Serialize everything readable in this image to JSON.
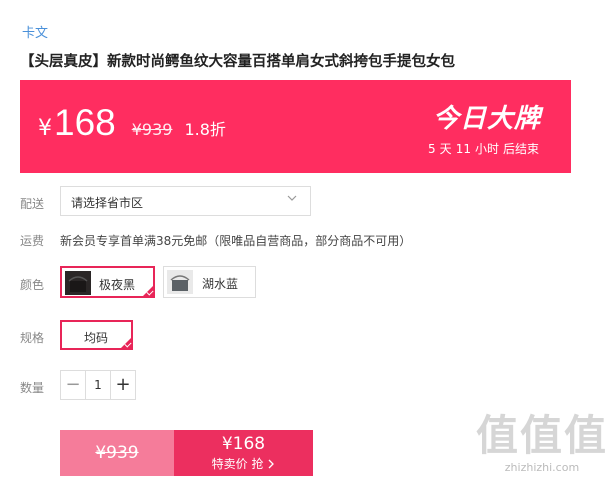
{
  "brand": "卡文",
  "product_title": "【头层真皮】新款时尚鳄鱼纹大容量百搭单肩女式斜挎包手提包女包",
  "price": {
    "currency": "¥",
    "current": "168",
    "original": "¥939",
    "discount": "1.8折"
  },
  "promo": {
    "badge": "今日大牌",
    "countdown": {
      "days": "5",
      "days_unit": "天",
      "hours": "11",
      "hours_unit": "小时",
      "suffix": "后结束"
    }
  },
  "delivery": {
    "label": "配送",
    "placeholder": "请选择省市区"
  },
  "shipping": {
    "label": "运费",
    "text": "新会员专享首单满38元免邮（限唯品自营商品，部分商品不可用）"
  },
  "color": {
    "label": "颜色",
    "options": [
      {
        "label": "极夜黑",
        "selected": true
      },
      {
        "label": "湖水蓝",
        "selected": false
      }
    ]
  },
  "size": {
    "label": "规格",
    "options": [
      {
        "label": "均码",
        "selected": true
      }
    ]
  },
  "quantity": {
    "label": "数量",
    "value": "1"
  },
  "buy_button": {
    "original_price": "¥939",
    "price": "¥168",
    "action": "特卖价 抢"
  },
  "watermark": {
    "logo": "值值值",
    "site": "zhizhizhi.com"
  },
  "colors": {
    "accent": "#ff2d60",
    "buy_left": "#f57c9a",
    "buy_right": "#ec2f5f",
    "link": "#4a90d9"
  }
}
